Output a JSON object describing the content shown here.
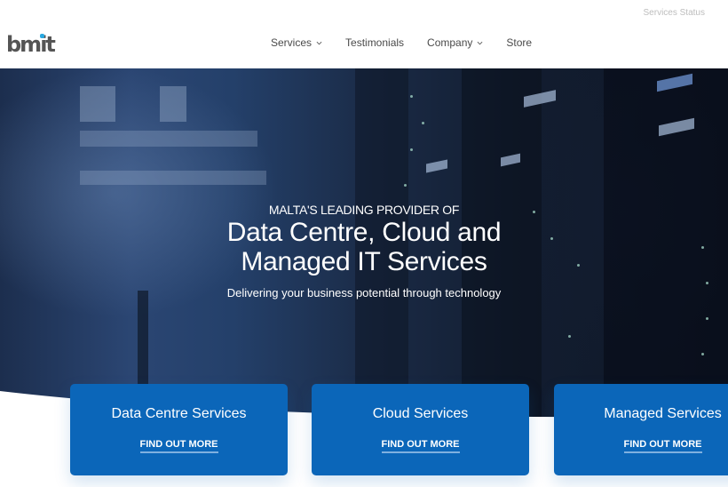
{
  "header": {
    "logo_text": "bmit",
    "status_link": "Services Status",
    "nav": [
      {
        "label": "Services",
        "has_dropdown": true
      },
      {
        "label": "Testimonials",
        "has_dropdown": false
      },
      {
        "label": "Company",
        "has_dropdown": true
      },
      {
        "label": "Store",
        "has_dropdown": false
      }
    ]
  },
  "hero": {
    "eyebrow": "MALTA'S LEADING PROVIDER OF",
    "headline_line1": "Data Centre, Cloud and",
    "headline_line2": "Managed IT Services",
    "subheadline": "Delivering your business potential through technology"
  },
  "cards": [
    {
      "title": "Data Centre Services",
      "link": "FIND OUT MORE"
    },
    {
      "title": "Cloud Services",
      "link": "FIND OUT MORE"
    },
    {
      "title": "Managed Services",
      "link": "FIND OUT MORE"
    }
  ],
  "colors": {
    "brand_blue": "#0b66b9",
    "logo_accent": "#29a8e0",
    "nav_text": "#4a4a4a"
  }
}
